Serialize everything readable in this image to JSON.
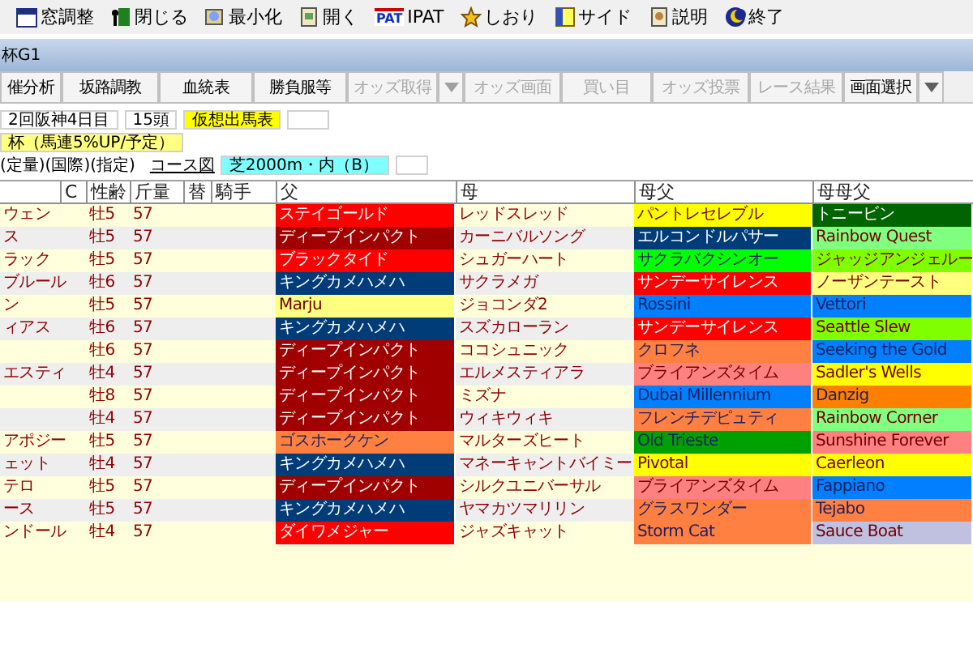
{
  "toolbar": [
    {
      "label": "窓調整"
    },
    {
      "label": "閉じる"
    },
    {
      "label": "最小化"
    },
    {
      "label": "開く"
    },
    {
      "label": "IPAT",
      "badge": "PAT"
    },
    {
      "label": "しおり"
    },
    {
      "label": "サイド"
    },
    {
      "label": "説明"
    },
    {
      "label": "終了"
    }
  ],
  "window": {
    "title": "杯G1"
  },
  "buttons": [
    {
      "label": "催分析",
      "disabled": false,
      "dropdown": false
    },
    {
      "label": "坂路調教",
      "disabled": false,
      "dropdown": false
    },
    {
      "label": "血統表",
      "disabled": false,
      "dropdown": false
    },
    {
      "label": "勝負服等",
      "disabled": false,
      "dropdown": false
    },
    {
      "label": "オッズ取得",
      "disabled": true,
      "dropdown": true
    },
    {
      "label": "オッズ画面",
      "disabled": true,
      "dropdown": false
    },
    {
      "label": "買い目",
      "disabled": true,
      "dropdown": false
    },
    {
      "label": "オッズ投票",
      "disabled": true,
      "dropdown": false
    },
    {
      "label": "レース結果",
      "disabled": true,
      "dropdown": false
    },
    {
      "label": "画面選択",
      "disabled": false,
      "dropdown": true
    }
  ],
  "race": {
    "meeting": "2回阪神4日目",
    "runners": "15頭",
    "mode": "仮想出馬表",
    "name": "杯（馬連5%UP/予定）",
    "conditions": "(定量)(国際)(指定)",
    "course_link": "コース図",
    "course": "芝2000m・内（B）"
  },
  "table": {
    "columns": [
      "C",
      "性齢",
      "斤量",
      "替",
      "騎手",
      "父",
      "母",
      "母父",
      "母母父"
    ],
    "rows": [
      {
        "name": "ウェン",
        "sex_age": "牡5",
        "weight": "57",
        "sire": {
          "name": "ステイゴールド",
          "color": "#ff0000"
        },
        "dam": "レッドスレッド",
        "damsire": {
          "name": "パントレセレブル",
          "color": "#ffff00"
        },
        "ddsire": {
          "name": "トニービン",
          "color": "#006400"
        }
      },
      {
        "name": "ス",
        "sex_age": "牡5",
        "weight": "57",
        "sire": {
          "name": "ディープインパクト",
          "color": "#a00000"
        },
        "dam": "カーニバルソング",
        "damsire": {
          "name": "エルコンドルパサー",
          "color": "#003c78"
        },
        "ddsire": {
          "name": "Rainbow Quest",
          "color": "#80ff80"
        }
      },
      {
        "name": "ラック",
        "sex_age": "牡5",
        "weight": "57",
        "sire": {
          "name": "ブラックタイド",
          "color": "#ff0000"
        },
        "dam": "シュガーハート",
        "damsire": {
          "name": "サクラバクシンオー",
          "color": "#00ff00"
        },
        "ddsire": {
          "name": "ジャッジアンジェルー",
          "color": "#80ff00"
        }
      },
      {
        "name": "ブルール",
        "sex_age": "牡6",
        "weight": "57",
        "sire": {
          "name": "キングカメハメハ",
          "color": "#003c78"
        },
        "dam": "サクラメガ",
        "damsire": {
          "name": "サンデーサイレンス",
          "color": "#ff0000"
        },
        "ddsire": {
          "name": "ノーザンテースト",
          "color": "#ffff80"
        }
      },
      {
        "name": "ン",
        "sex_age": "牡5",
        "weight": "57",
        "sire": {
          "name": "Marju",
          "color": "#ffff80"
        },
        "dam": "ジョコンダ2",
        "damsire": {
          "name": "Rossini",
          "color": "#0080ff"
        },
        "ddsire": {
          "name": "Vettori",
          "color": "#0080ff"
        }
      },
      {
        "name": "ィアス",
        "sex_age": "牡6",
        "weight": "57",
        "sire": {
          "name": "キングカメハメハ",
          "color": "#003c78"
        },
        "dam": "スズカローラン",
        "damsire": {
          "name": "サンデーサイレンス",
          "color": "#ff0000"
        },
        "ddsire": {
          "name": "Seattle Slew",
          "color": "#80ff00"
        }
      },
      {
        "sex_age": "牡6",
        "weight": "57",
        "sire": {
          "name": "ディープインパクト",
          "color": "#a00000"
        },
        "dam": "ココシュニック",
        "damsire": {
          "name": "クロフネ",
          "color": "#ff8040"
        },
        "ddsire": {
          "name": "Seeking the Gold",
          "color": "#0080ff"
        }
      },
      {
        "name": "エスティ",
        "sex_age": "牡4",
        "weight": "57",
        "sire": {
          "name": "ディープインパクト",
          "color": "#a00000"
        },
        "dam": "エルメスティアラ",
        "damsire": {
          "name": "ブライアンズタイム",
          "color": "#ff8080"
        },
        "ddsire": {
          "name": "Sadler's Wells",
          "color": "#ffff00"
        }
      },
      {
        "sex_age": "牡8",
        "weight": "57",
        "sire": {
          "name": "ディープインパクト",
          "color": "#a00000"
        },
        "dam": "ミズナ",
        "damsire": {
          "name": "Dubai Millennium",
          "color": "#0080ff"
        },
        "ddsire": {
          "name": "Danzig",
          "color": "#ff8000"
        }
      },
      {
        "sex_age": "牡4",
        "weight": "57",
        "sire": {
          "name": "ディープインパクト",
          "color": "#a00000"
        },
        "dam": "ウィキウィキ",
        "damsire": {
          "name": "フレンチデピュティ",
          "color": "#ff8040"
        },
        "ddsire": {
          "name": "Rainbow Corner",
          "color": "#80ff80"
        }
      },
      {
        "name": "アポジー",
        "sex_age": "牡5",
        "weight": "57",
        "sire": {
          "name": "ゴスホークケン",
          "color": "#ff8040"
        },
        "dam": "マルターズヒート",
        "damsire": {
          "name": "Old Trieste",
          "color": "#00a000"
        },
        "ddsire": {
          "name": "Sunshine Forever",
          "color": "#ff8080"
        }
      },
      {
        "name": "ェット",
        "sex_age": "牡4",
        "weight": "57",
        "sire": {
          "name": "キングカメハメハ",
          "color": "#003c78"
        },
        "dam": "マネーキャントバイミー",
        "damsire": {
          "name": "Pivotal",
          "color": "#ffff00"
        },
        "ddsire": {
          "name": "Caerleon",
          "color": "#ffff00"
        }
      },
      {
        "name": "テロ",
        "sex_age": "牡5",
        "weight": "57",
        "sire": {
          "name": "ディープインパクト",
          "color": "#a00000"
        },
        "dam": "シルクユニバーサル",
        "damsire": {
          "name": "ブライアンズタイム",
          "color": "#ff8080"
        },
        "ddsire": {
          "name": "Fappiano",
          "color": "#0080ff"
        }
      },
      {
        "name": "ース",
        "sex_age": "牡5",
        "weight": "57",
        "sire": {
          "name": "キングカメハメハ",
          "color": "#003c78"
        },
        "dam": "ヤマカツマリリン",
        "damsire": {
          "name": "グラスワンダー",
          "color": "#ff8040"
        },
        "ddsire": {
          "name": "Tejabo",
          "color": "#ff8040"
        }
      },
      {
        "name": "ンドール",
        "sex_age": "牡4",
        "weight": "57",
        "sire": {
          "name": "ダイワメジャー",
          "color": "#ff0000"
        },
        "dam": "ジャズキャット",
        "damsire": {
          "name": "Storm Cat",
          "color": "#ff8040"
        },
        "ddsire": {
          "name": "Sauce Boat",
          "color": "#c0c0e0"
        }
      }
    ]
  }
}
